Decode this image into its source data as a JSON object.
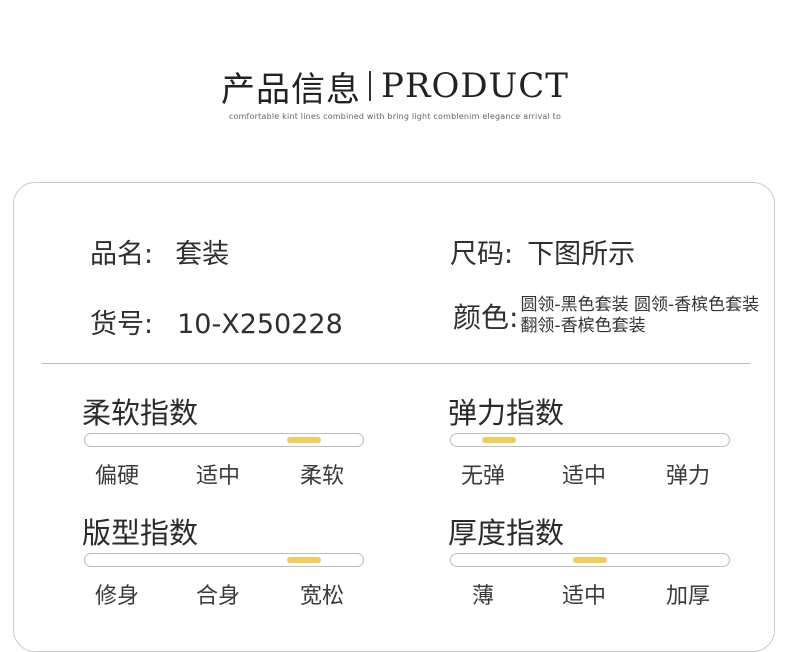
{
  "header": {
    "title_cn": "产品信息",
    "title_en": "PRODUCT",
    "subtitle": "comfortable kint lines combined with bring light comblenim elegance arrival to"
  },
  "info": {
    "name_label": "品名:",
    "name_value": "套装",
    "size_label": "尺码:",
    "size_value": "下图所示",
    "sku_label": "货号:",
    "sku_value": "10-X250228",
    "color_label": "颜色:",
    "color_value": "圆领-黑色套装 圆领-香槟色套装 翻领-香槟色套装"
  },
  "indices": {
    "softness": {
      "title": "柔软指数",
      "ticks": [
        "偏硬",
        "适中",
        "柔软"
      ],
      "level": 0.85
    },
    "elasticity": {
      "title": "弹力指数",
      "ticks": [
        "无弹",
        "适中",
        "弹力"
      ],
      "level": 0.1
    },
    "fit": {
      "title": "版型指数",
      "ticks": [
        "修身",
        "合身",
        "宽松"
      ],
      "level": 0.85
    },
    "thickness": {
      "title": "厚度指数",
      "ticks": [
        "薄",
        "适中",
        "加厚"
      ],
      "level": 0.5
    }
  },
  "colors": {
    "accent": "#f0cc58",
    "border": "#c9c9c9"
  }
}
